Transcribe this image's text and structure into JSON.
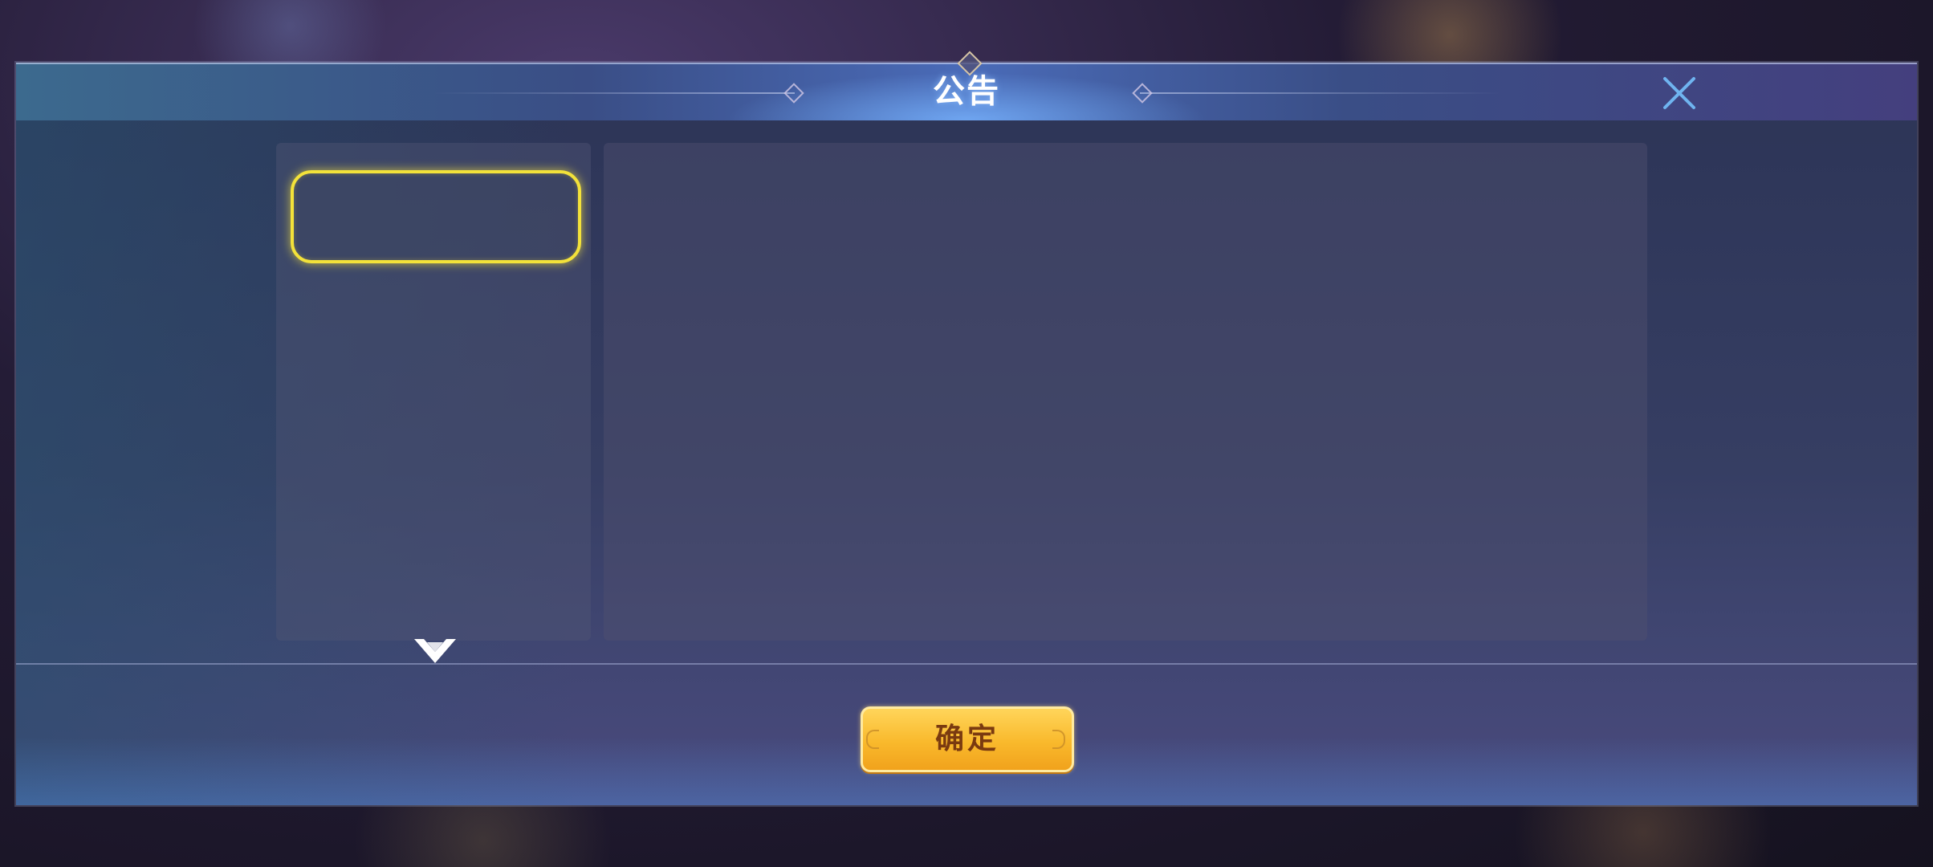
{
  "header": {
    "title": "公告"
  },
  "close_button": {
    "icon": "close-icon",
    "color": "#6fb4f0"
  },
  "announcement_list": {
    "items": [
      {
        "label": "",
        "selected": true
      }
    ],
    "scroll_icon": "chevron-down-icon"
  },
  "content_panel": {
    "text": ""
  },
  "footer": {
    "confirm_label": "确定"
  },
  "colors": {
    "accent_yellow": "#f3e23a",
    "button_gold": "#f9b92c",
    "button_text": "#7a3a10"
  }
}
